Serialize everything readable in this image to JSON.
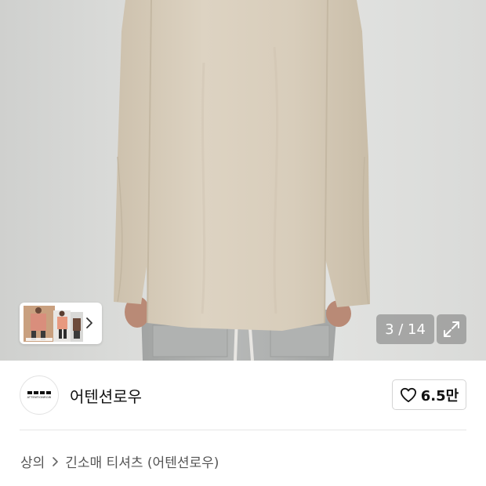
{
  "gallery": {
    "counter": "3 / 14",
    "expand_icon": "expand-arrows-icon",
    "thumb_chevron_icon": "chevron-right-icon"
  },
  "brand": {
    "name": "어텐션로우",
    "logo_text": "ATTENTIONROW",
    "like_icon": "heart-outline-icon",
    "like_count": "6.5만"
  },
  "breadcrumb": {
    "category": "상의",
    "separator_icon": "chevron-right-icon",
    "subcategory": "긴소매 티셔츠 (어텐션로우)"
  },
  "colors": {
    "shirt": "#d6cbb8",
    "pants": "#a9abaa",
    "counter_bg": "#7a7a7a"
  }
}
